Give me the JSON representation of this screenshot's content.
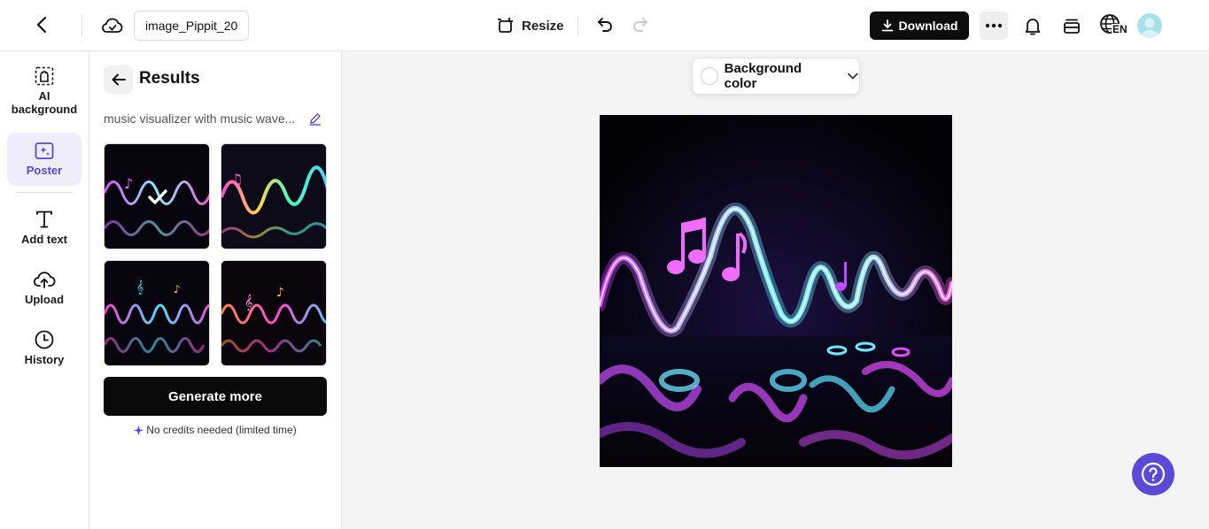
{
  "topbar": {
    "filename": "image_Pippit_20",
    "resize_label": "Resize",
    "download_label": "Download",
    "language": "EN",
    "icons": [
      "back-icon",
      "cloud-icon",
      "resize-icon",
      "undo-icon",
      "redo-icon",
      "download-icon",
      "more-icon",
      "bell-icon",
      "stack-icon",
      "globe-icon",
      "avatar"
    ]
  },
  "leftnav": {
    "items": [
      {
        "label": "AI\nbackground",
        "icon": "ai-background-icon"
      },
      {
        "label": "Poster",
        "icon": "poster-icon",
        "active": true
      },
      {
        "label": "Add text",
        "icon": "text-icon"
      },
      {
        "label": "Upload",
        "icon": "upload-icon"
      },
      {
        "label": "History",
        "icon": "history-icon"
      }
    ]
  },
  "panel": {
    "title": "Results",
    "prompt": "music visualizer with music wave...",
    "generate_label": "Generate more",
    "credits_note": "No credits needed (limited time)"
  },
  "canvas": {
    "background_color_label": "Background color"
  },
  "colors": {
    "accent": "#5b4ad8",
    "download_bg": "#0d0d0d",
    "active_nav_bg": "#efedfb"
  }
}
